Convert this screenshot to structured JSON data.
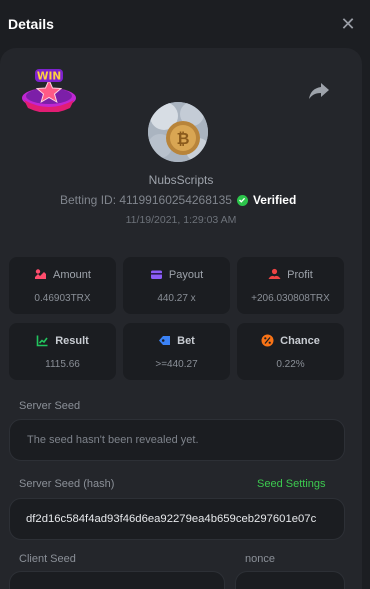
{
  "modal": {
    "title": "Details",
    "close_glyph": "✕",
    "badge_text": "WIN",
    "share_icon": "share-icon"
  },
  "user": {
    "username": "NubsScripts",
    "betting_id": "Betting ID: 41199160254268135",
    "verified_label": "Verified",
    "timestamp": "11/19/2021, 1:29:03 AM"
  },
  "stats": {
    "amount": {
      "label": "Amount",
      "value": "0.46903TRX",
      "icon": "coins-icon",
      "color": "#ff4d6d"
    },
    "payout": {
      "label": "Payout",
      "value": "440.27 x",
      "icon": "wallet-icon",
      "color": "#8b5cf6"
    },
    "profit": {
      "label": "Profit",
      "value": "+206.030808TRX",
      "icon": "profit-icon",
      "color": "#ef4444"
    },
    "result": {
      "label": "Result",
      "value": "1115.66",
      "icon": "chart-icon",
      "color": "#22c55e"
    },
    "bet": {
      "label": "Bet",
      "value": ">=440.27",
      "icon": "tag-icon",
      "color": "#3b82f6"
    },
    "chance": {
      "label": "Chance",
      "value": "0.22%",
      "icon": "percent-icon",
      "color": "#f97316"
    }
  },
  "seeds": {
    "server_seed_label": "Server Seed",
    "server_seed_value": "The seed hasn't been revealed yet.",
    "server_hash_label": "Server Seed (hash)",
    "seed_settings_label": "Seed Settings",
    "server_hash_value": "df2d16c584f4ad93f46d6ea92279ea4b659ceb297601e07c",
    "client_seed_label": "Client Seed",
    "nonce_label": "nonce"
  },
  "colors": {
    "accent_green": "#3cc94f",
    "panel": "#24262b",
    "card": "#1b1d21"
  }
}
